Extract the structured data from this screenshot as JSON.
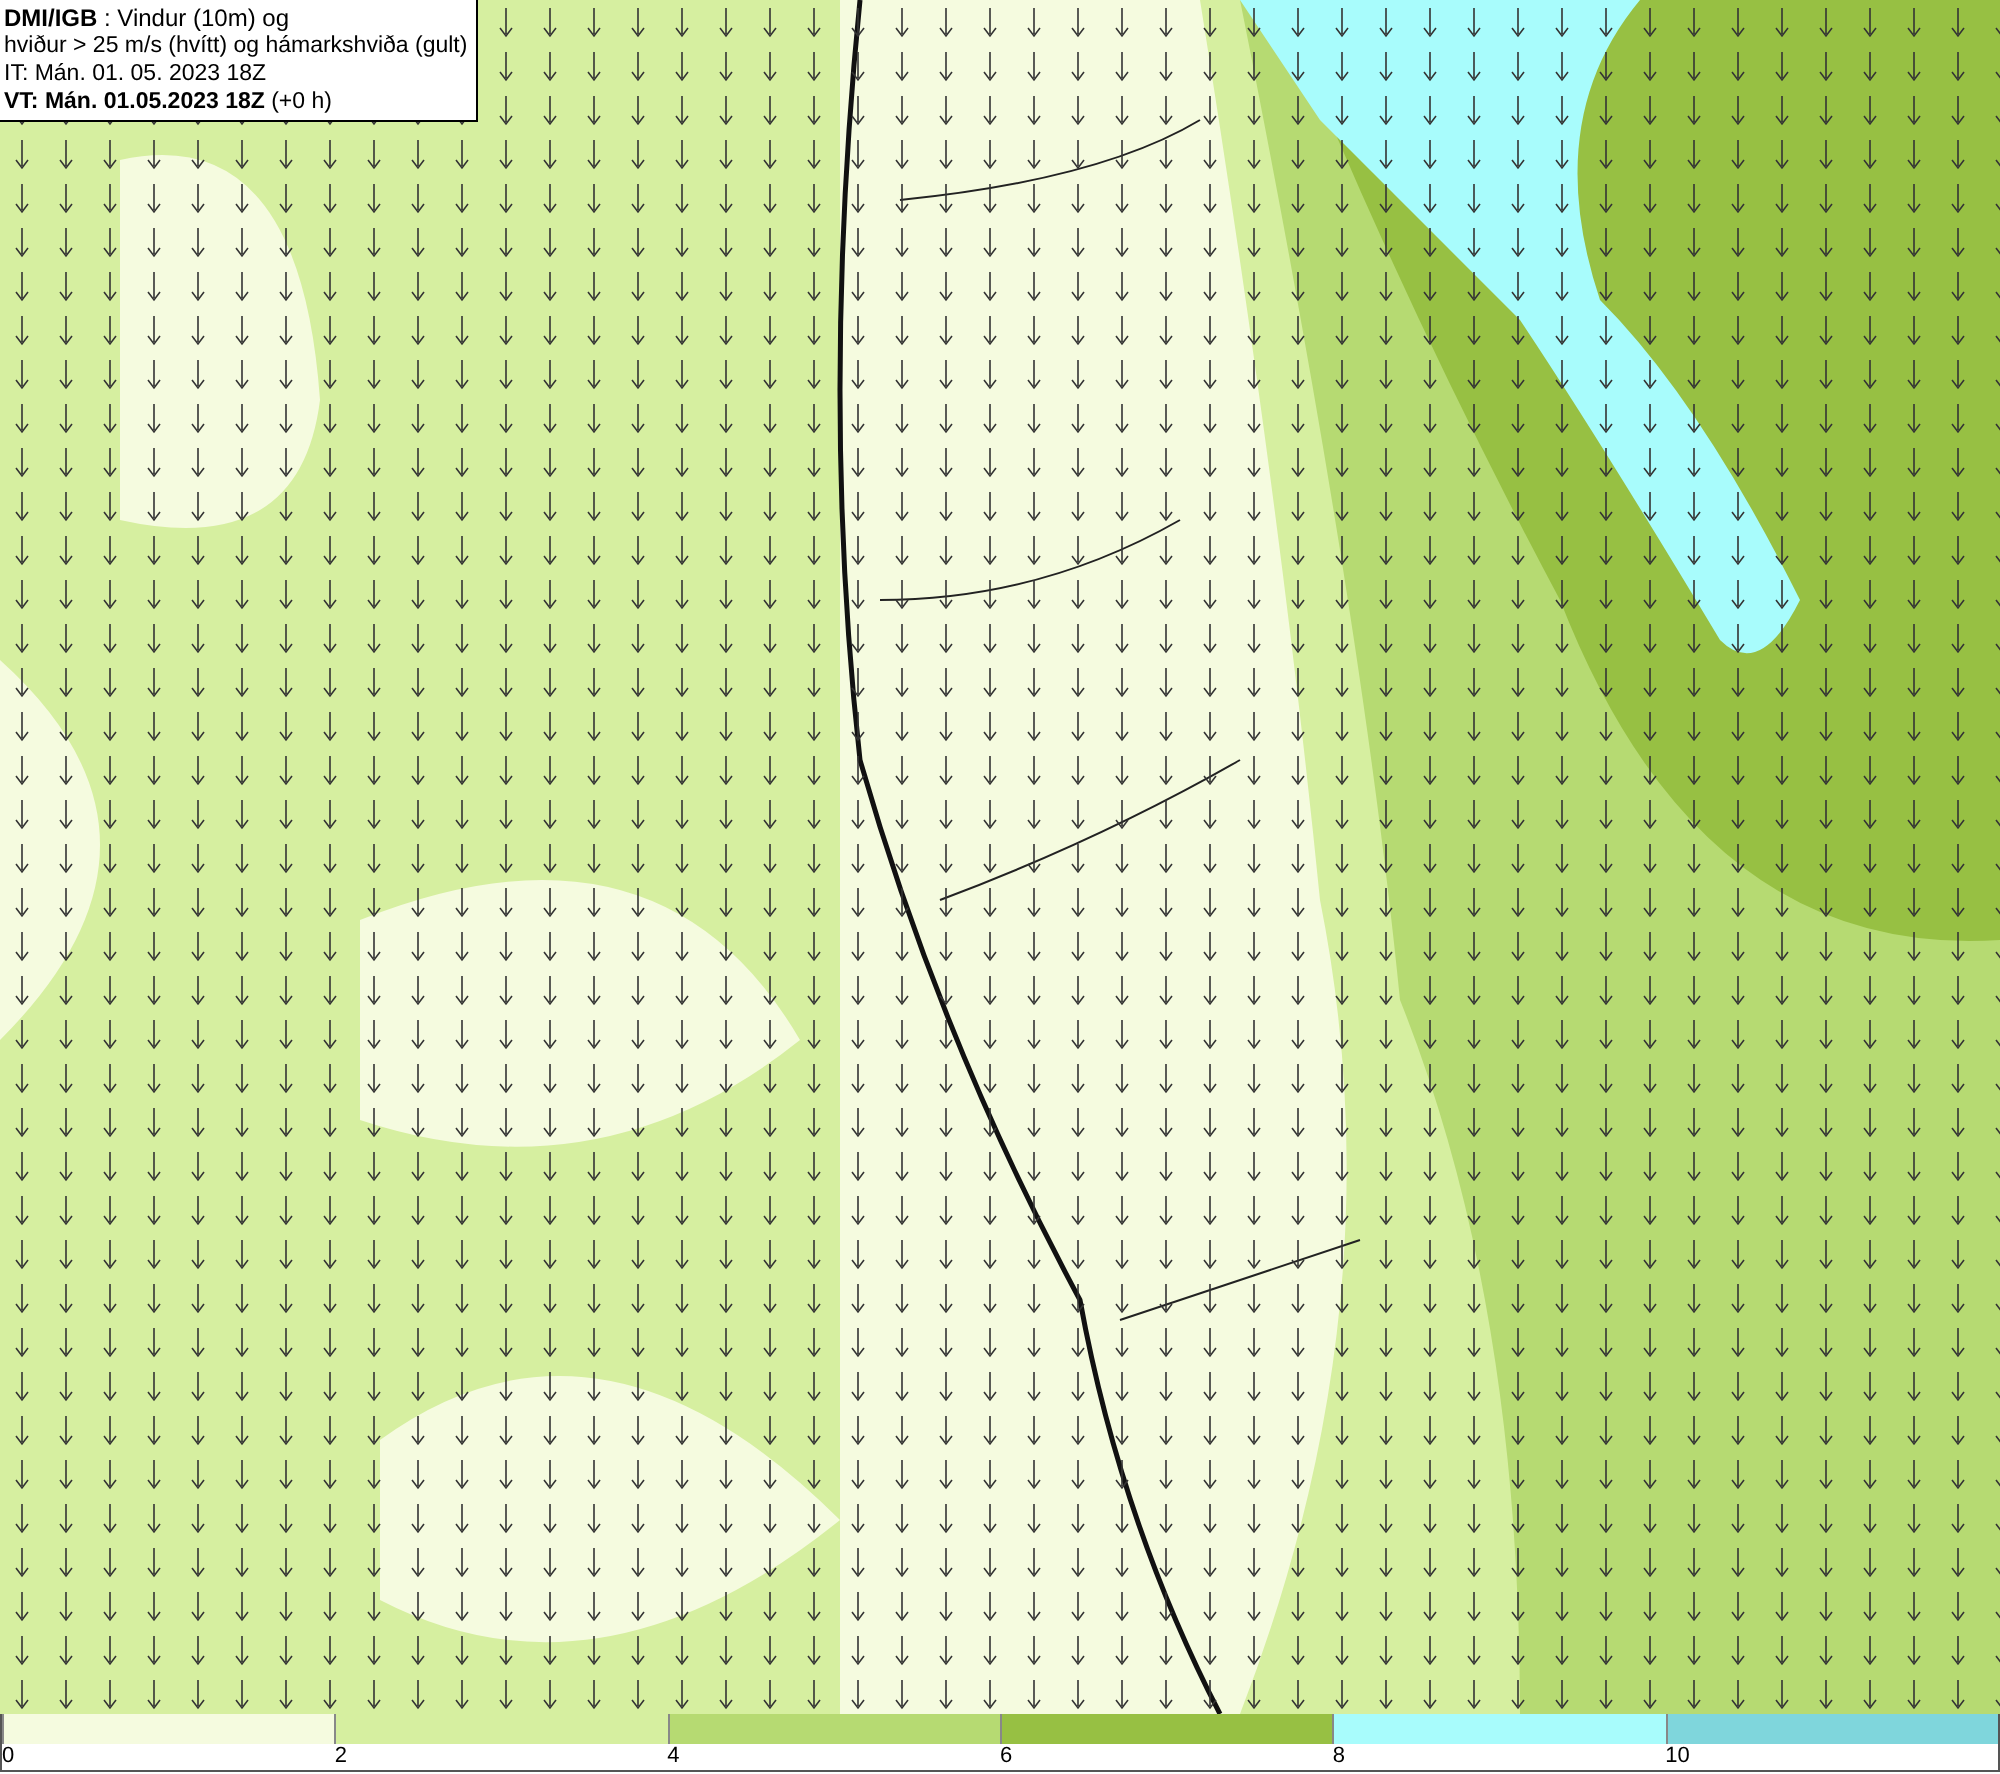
{
  "header": {
    "lines": [
      "**DMI/IGB** : Vindur (10m) og",
      "hviður > 25 m/s (hvítt) og hámarkshviða (gult)",
      "IT: Mán. 01. 05. 2023 18Z",
      "**VT: Mán. 01.05.2023 18Z** (+0 h)"
    ]
  },
  "legend": {
    "segments": [
      {
        "color": "#f5fbdf",
        "tick": "0"
      },
      {
        "color": "#d6efa0",
        "tick": "2"
      },
      {
        "color": "#b6da72",
        "tick": "4"
      },
      {
        "color": "#97c043",
        "tick": "6"
      },
      {
        "color": "#a8fcfc",
        "tick": "8"
      },
      {
        "color": "#7fd6dc",
        "tick": "10"
      }
    ]
  }
}
